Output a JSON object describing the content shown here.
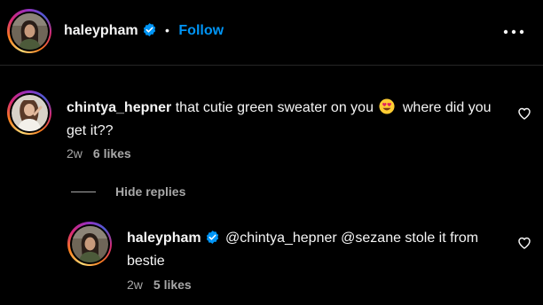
{
  "header": {
    "username": "haleypham",
    "separator": "•",
    "follow_label": "Follow",
    "more_icon": "more-horizontal-icon"
  },
  "comment": {
    "username": "chintya_hepner",
    "text_before_emoji": "that cutie green sweater on you",
    "emoji": "heart-eyes-emoji",
    "text_after_emoji": "where did you get it??",
    "time": "2w",
    "likes": "6 likes"
  },
  "replies_toggle": {
    "label": "Hide replies"
  },
  "reply": {
    "username": "haleypham",
    "text": "@chintya_hepner @sezane stole it from bestie",
    "time": "2w",
    "likes": "5 likes"
  },
  "colors": {
    "background": "#000000",
    "text": "#f5f5f5",
    "muted": "#a8a8a8",
    "accent": "#0095f6",
    "verified": "#0095f6"
  }
}
